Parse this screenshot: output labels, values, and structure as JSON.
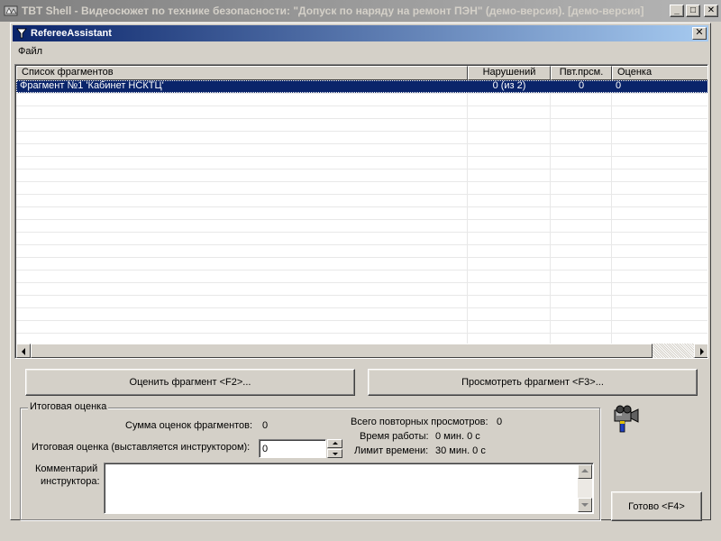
{
  "outer_window": {
    "title": "TBT Shell - Видеосюжет по технике безопасности: \"Допуск по наряду на ремонт ПЭН\" (демо-версия). [демо-версия]",
    "minimize_glyph": "_",
    "maximize_glyph": "□",
    "close_glyph": "✕"
  },
  "inner_window": {
    "title": "RefereeAssistant",
    "close_glyph": "✕"
  },
  "menu": {
    "items": [
      {
        "label": "Файл"
      }
    ]
  },
  "fragments_list": {
    "columns": [
      "Список фрагментов",
      "Нарушений",
      "Пвт.прсм.",
      "Оценка"
    ],
    "rows": [
      {
        "name": "Фрагмент №1 'Кабинет НСКТЦ'",
        "violations": "0 (из 2)",
        "reviews": "0",
        "score": "0"
      }
    ]
  },
  "buttons": {
    "evaluate": "Оценить фрагмент <F2>...",
    "view": "Просмотреть фрагмент  <F3>...",
    "done": "Готово <F4>"
  },
  "final_score": {
    "group_title": "Итоговая оценка",
    "sum_label": "Сумма оценок фрагментов:",
    "sum_value": "0",
    "final_label": "Итоговая оценка (выставляется инструктором):",
    "final_value": "0",
    "total_reviews_label": "Всего повторных просмотров:",
    "total_reviews_value": "0",
    "work_time_label": "Время работы:",
    "work_time_value": "0 мин. 0 с",
    "time_limit_label": "Лимит времени:",
    "time_limit_value": "30 мин. 0 с",
    "comment_label_line1": "Комментарий",
    "comment_label_line2": "инструктора:",
    "comment_value": ""
  },
  "colors": {
    "selection": "#0a246a",
    "face": "#d4d0c8",
    "active_title_start": "#0a246a",
    "active_title_end": "#a6caf0"
  },
  "icons": {
    "app": "tbt-app-icon",
    "window": "referee-window-icon",
    "camera": "video-camera-icon"
  }
}
